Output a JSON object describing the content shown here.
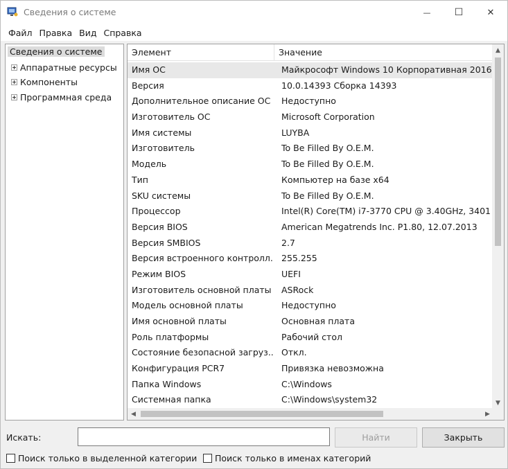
{
  "window": {
    "title": "Сведения о системе",
    "minimize_glyph": "—",
    "maximize_glyph": "☐",
    "close_glyph": "✕"
  },
  "menu": [
    "Файл",
    "Правка",
    "Вид",
    "Справка"
  ],
  "tree": {
    "root": "Сведения о системе",
    "children": [
      "Аппаратные ресурсы",
      "Компоненты",
      "Программная среда"
    ]
  },
  "list": {
    "columns": [
      "Элемент",
      "Значение"
    ],
    "rows": [
      {
        "item": "Имя ОС",
        "value": "Майкрософт Windows 10 Корпоративная 2016"
      },
      {
        "item": "Версия",
        "value": "10.0.14393 Сборка 14393"
      },
      {
        "item": "Дополнительное описание ОС",
        "value": "Недоступно"
      },
      {
        "item": "Изготовитель ОС",
        "value": "Microsoft Corporation"
      },
      {
        "item": "Имя системы",
        "value": "LUYBA"
      },
      {
        "item": "Изготовитель",
        "value": "To Be Filled By O.E.M."
      },
      {
        "item": "Модель",
        "value": "To Be Filled By O.E.M."
      },
      {
        "item": "Тип",
        "value": "Компьютер на базе x64"
      },
      {
        "item": "SKU системы",
        "value": "To Be Filled By O.E.M."
      },
      {
        "item": "Процессор",
        "value": "Intel(R) Core(TM) i7-3770 CPU @ 3.40GHz, 3401"
      },
      {
        "item": "Версия BIOS",
        "value": "American Megatrends Inc. P1.80, 12.07.2013"
      },
      {
        "item": "Версия SMBIOS",
        "value": "2.7"
      },
      {
        "item": "Версия встроенного контролл...",
        "value": "255.255"
      },
      {
        "item": "Режим BIOS",
        "value": "UEFI"
      },
      {
        "item": "Изготовитель основной платы",
        "value": "ASRock"
      },
      {
        "item": "Модель основной платы",
        "value": "Недоступно"
      },
      {
        "item": "Имя основной платы",
        "value": "Основная плата"
      },
      {
        "item": "Роль платформы",
        "value": "Рабочий стол"
      },
      {
        "item": "Состояние безопасной загруз...",
        "value": "Откл."
      },
      {
        "item": "Конфигурация PCR7",
        "value": "Привязка невозможна"
      },
      {
        "item": "Папка Windows",
        "value": "C:\\Windows"
      },
      {
        "item": "Системная папка",
        "value": "C:\\Windows\\system32"
      }
    ],
    "selected_index": 0
  },
  "search": {
    "label": "Искать:",
    "value": "",
    "find_button": "Найти",
    "close_button": "Закрыть",
    "option_selected_category": "Поиск только в выделенной категории",
    "option_category_names": "Поиск только в именах категорий"
  },
  "colors": {
    "selection": "#e8e8e8",
    "tree_root_highlight": "#dcdcdc",
    "scroll_thumb": "#c2c2c2"
  }
}
